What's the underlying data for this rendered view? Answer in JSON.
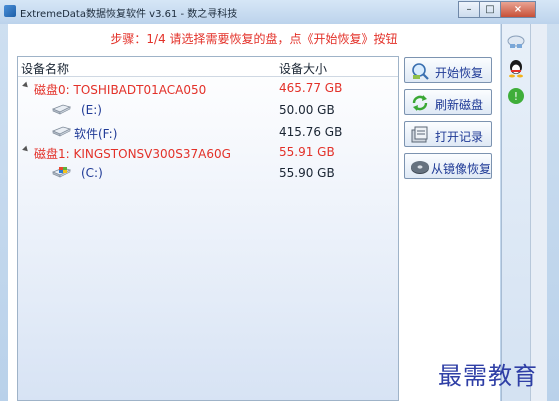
{
  "window": {
    "title": "ExtremeData数据恢复软件 v3.61  - 数之寻科技",
    "controls": {
      "minimize": "–",
      "maximize": "□",
      "close": "×"
    }
  },
  "step_text": "步骤：1/4 请选择需要恢复的盘，点《开始恢复》按钮",
  "list": {
    "headers": {
      "name": "设备名称",
      "size": "设备大小"
    },
    "rows": [
      {
        "type": "disk",
        "name": "磁盘0: TOSHIBADT01ACA050",
        "size": "465.77 GB"
      },
      {
        "type": "partition",
        "name": "(E:)",
        "size": "50.00 GB",
        "icon": "hard-drive-icon"
      },
      {
        "type": "partition",
        "name": "软件(F:)",
        "size": "415.76 GB",
        "icon": "hard-drive-icon"
      },
      {
        "type": "disk",
        "name": "磁盘1: KINGSTONSV300S37A60G",
        "size": "55.91 GB"
      },
      {
        "type": "partition",
        "name": "(C:)",
        "size": "55.90 GB",
        "icon": "system-drive-icon"
      }
    ]
  },
  "buttons": {
    "start_recovery": "开始恢复",
    "refresh_disk": "刷新磁盘",
    "open_record": "打开记录",
    "recover_from_image": "从镜像恢复"
  },
  "watermark": "最需教育",
  "colors": {
    "accent_red": "#e33129",
    "link_blue": "#1f3a96"
  }
}
